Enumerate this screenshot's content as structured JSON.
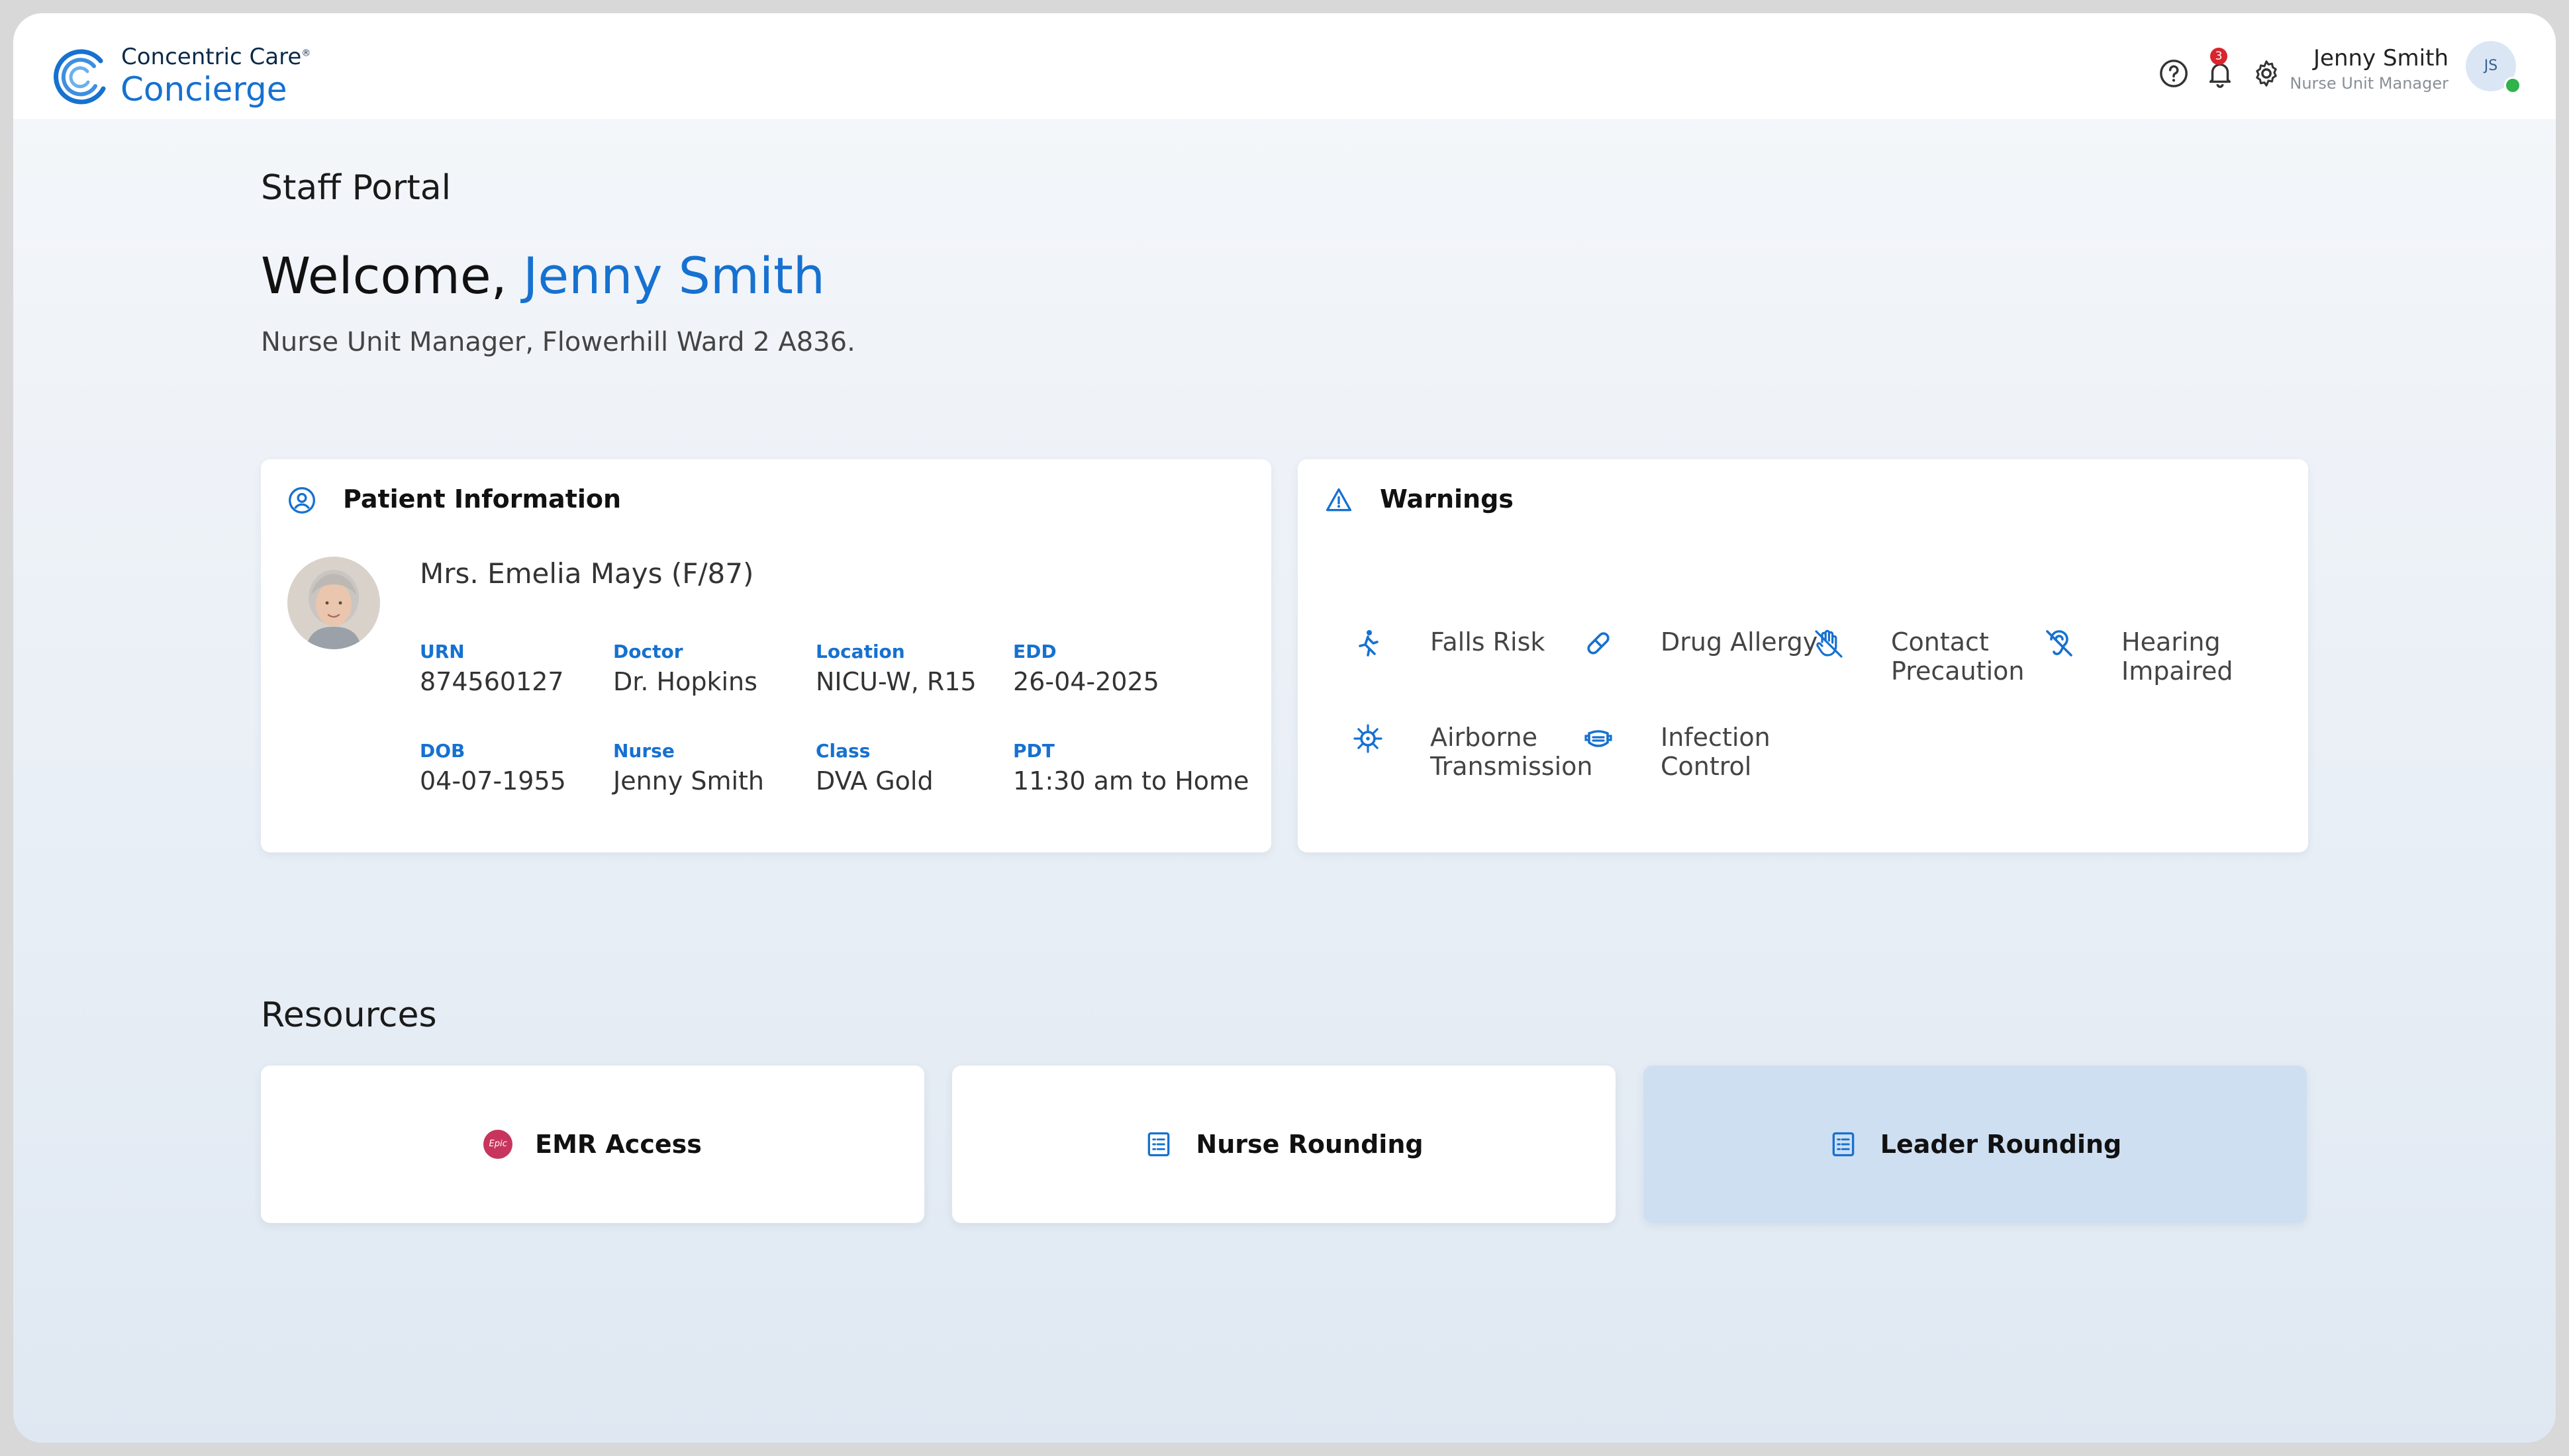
{
  "brand": {
    "line1": "Concentric Care",
    "trademark": "®",
    "line2": "Concierge"
  },
  "header": {
    "notification_count": "3",
    "user_name": "Jenny Smith",
    "user_role": "Nurse Unit Manager",
    "avatar_initials": "JS"
  },
  "page": {
    "title": "Staff Portal",
    "welcome_prefix": "Welcome, ",
    "welcome_name": "Jenny Smith",
    "subtitle": "Nurse Unit Manager, Flowerhill Ward 2 A836."
  },
  "patient_card": {
    "title": "Patient Information",
    "patient_name": "Mrs. Emelia Mays (F/87)",
    "fields": [
      {
        "label": "URN",
        "value": "874560127"
      },
      {
        "label": "Doctor",
        "value": "Dr. Hopkins"
      },
      {
        "label": "Location",
        "value": "NICU-W, R15"
      },
      {
        "label": "EDD",
        "value": "26-04-2025"
      },
      {
        "label": "DOB",
        "value": "04-07-1955"
      },
      {
        "label": "Nurse",
        "value": "Jenny Smith"
      },
      {
        "label": "Class",
        "value": "DVA Gold"
      },
      {
        "label": "PDT",
        "value": "11:30 am to Home"
      }
    ]
  },
  "warnings_card": {
    "title": "Warnings",
    "items": [
      {
        "label": "Falls Risk",
        "icon": "falls-icon"
      },
      {
        "label": "Drug Allergy",
        "icon": "pill-icon"
      },
      {
        "label": "Contact Precaution",
        "icon": "hand-icon"
      },
      {
        "label": "Hearing Impaired",
        "icon": "ear-off-icon"
      },
      {
        "label": "Airborne Transmission",
        "icon": "virus-icon"
      },
      {
        "label": "Infection Control",
        "icon": "mask-icon"
      }
    ]
  },
  "resources": {
    "title": "Resources",
    "items": [
      {
        "label": "EMR Access",
        "badge": "Epic"
      },
      {
        "label": "Nurse Rounding"
      },
      {
        "label": "Leader Rounding"
      }
    ]
  },
  "colors": {
    "accent": "#1671d0",
    "active_card": "#cfdff2",
    "badge_red": "#d9252c",
    "online_green": "#2fb34a",
    "epic_pink": "#c7355e"
  }
}
